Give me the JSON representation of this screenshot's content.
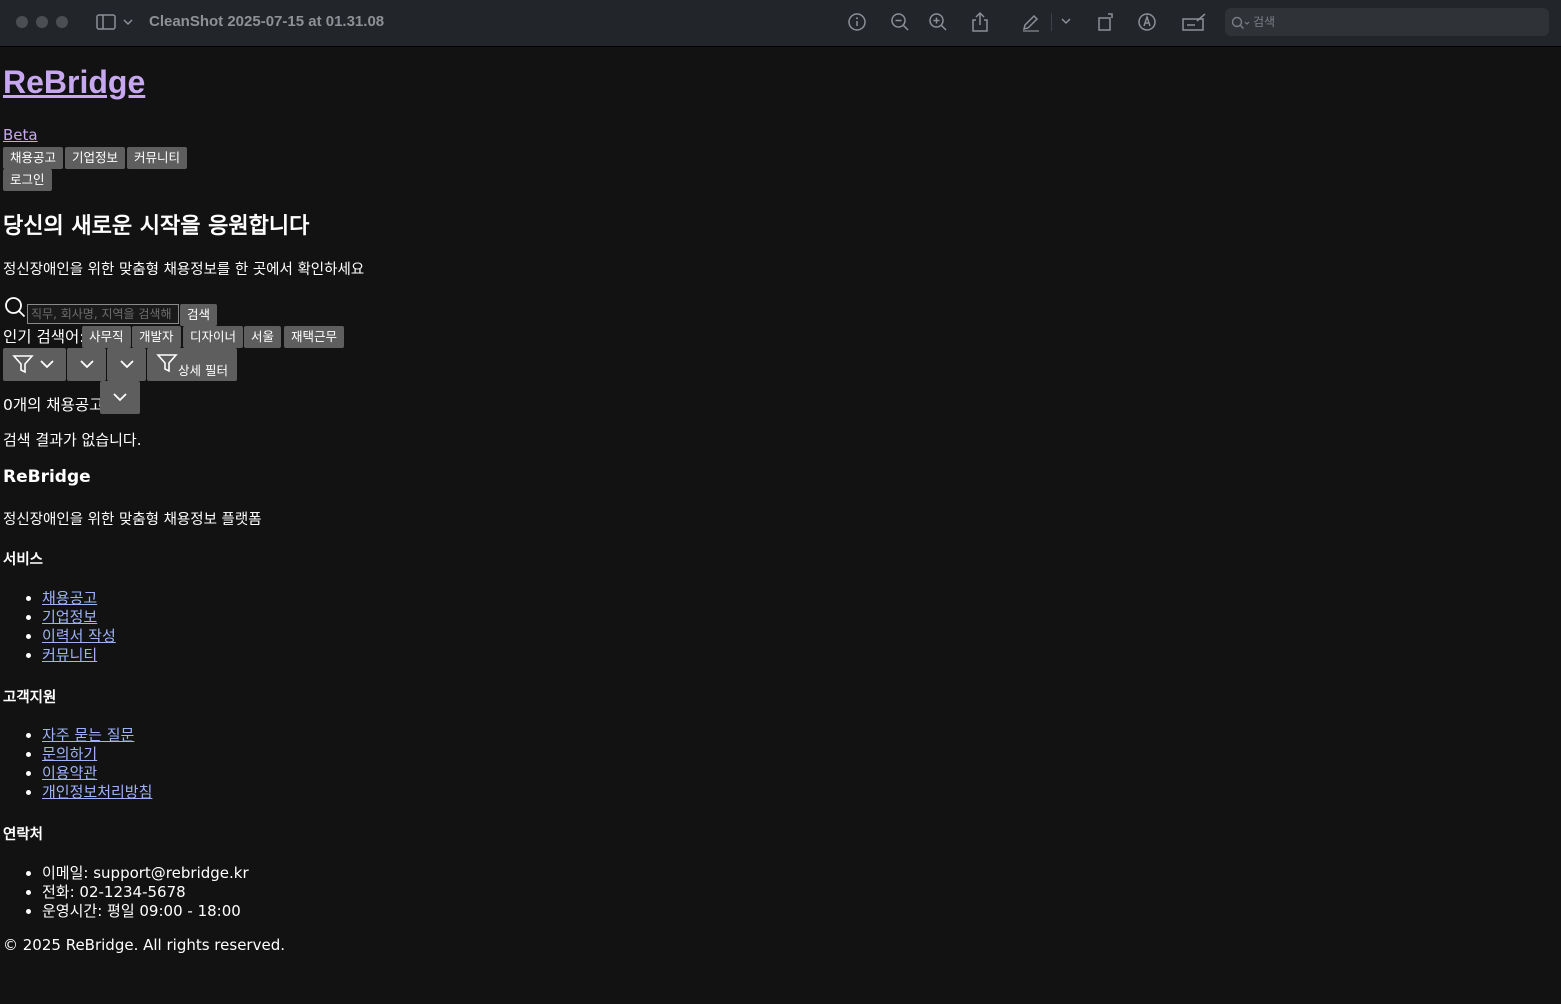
{
  "window": {
    "title": "CleanShot 2025-07-15 at 01.31.08",
    "search_placeholder": "검색"
  },
  "header": {
    "logo": "ReBridge",
    "badge": "Beta",
    "nav": [
      "채용공고",
      "기업정보",
      "커뮤니티"
    ],
    "login": "로그인"
  },
  "hero": {
    "title": "당신의 새로운 시작을 응원합니다",
    "subtitle": "정신장애인을 위한 맞춤형 채용정보를 한 곳에서 확인하세요"
  },
  "search": {
    "placeholder": "직무, 회사명, 지역을 검색해",
    "button": "검색",
    "popular_label": "인기 검색어:",
    "popular": [
      "사무직",
      "개발자",
      "디자이너",
      "서울",
      "재택근무"
    ]
  },
  "filters": {
    "detail_label": "상세 필터"
  },
  "results": {
    "count_text": "0개의 채용공고",
    "empty": "검색 결과가 없습니다."
  },
  "footer": {
    "brand": "ReBridge",
    "description": "정신장애인을 위한 맞춤형 채용정보 플랫폼",
    "services": {
      "title": "서비스",
      "items": [
        "채용공고",
        "기업정보",
        "이력서 작성",
        "커뮤니티"
      ]
    },
    "support": {
      "title": "고객지원",
      "items": [
        "자주 묻는 질문",
        "문의하기",
        "이용약관",
        "개인정보처리방침"
      ]
    },
    "contact": {
      "title": "연락처",
      "items": [
        "이메일: support@rebridge.kr",
        "전화: 02-1234-5678",
        "운영시간: 평일 09:00 - 18:00"
      ]
    },
    "copyright": "© 2025 ReBridge. All rights reserved."
  },
  "colors": {
    "background": "#121212",
    "button": "#5e5e5e",
    "link": "#9fb2f7",
    "visited_link": "#c7a8f0"
  }
}
